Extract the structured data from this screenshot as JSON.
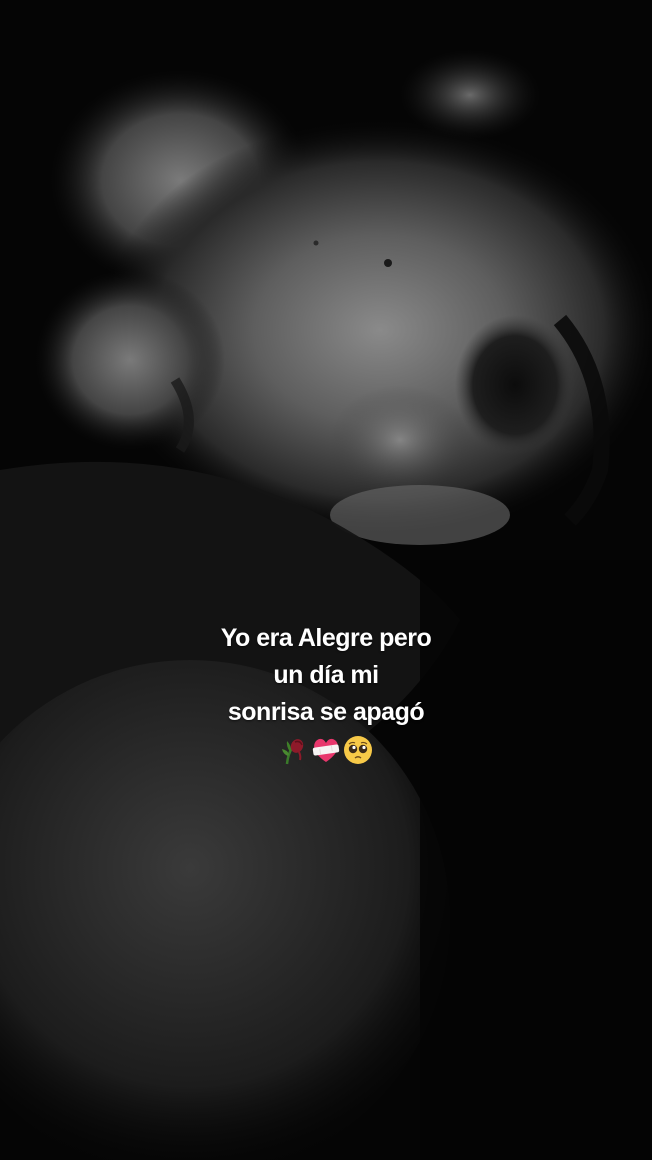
{
  "caption": {
    "lines": [
      "Yo era Alegre pero",
      "un día mi",
      "sonrisa se apagó"
    ],
    "emojis": [
      "wilted-rose-icon",
      "mending-heart-icon",
      "pleading-face-icon"
    ]
  },
  "colors": {
    "caption_text": "#ffffff",
    "background": "#050505"
  }
}
